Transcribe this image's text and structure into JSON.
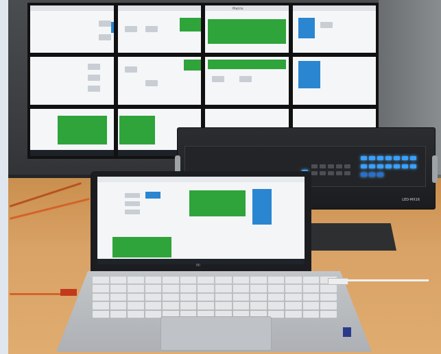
{
  "scene": {
    "description_tag": "photo",
    "colors": {
      "green_tile": "#2ea43a",
      "blue_tile": "#2a86d1",
      "led_blue": "#3aa0ff",
      "table_wood": "#d9a266"
    }
  },
  "videowall": {
    "tab_label": "Matrix"
  },
  "matrix_device": {
    "model_label": "LED-MX16"
  },
  "laptop": {
    "brand": "MI"
  }
}
